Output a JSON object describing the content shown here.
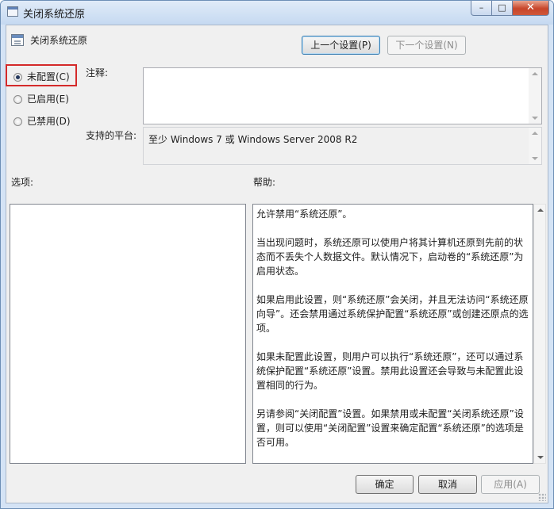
{
  "window": {
    "title": "关闭系统还原",
    "controls": {
      "minimize": "–",
      "maximize": "□",
      "close": "✕"
    }
  },
  "header": {
    "policy_name": "关闭系统还原",
    "prev_button": "上一个设置(P)",
    "next_button": "下一个设置(N)"
  },
  "state_options": {
    "selected": "not_configured",
    "items": [
      {
        "id": "not_configured",
        "label": "未配置(C)"
      },
      {
        "id": "enabled",
        "label": "已启用(E)"
      },
      {
        "id": "disabled",
        "label": "已禁用(D)"
      }
    ]
  },
  "comment": {
    "label": "注释:",
    "value": ""
  },
  "platform": {
    "label": "支持的平台:",
    "value": "至少 Windows 7 或 Windows Server 2008 R2"
  },
  "options": {
    "label": "选项:"
  },
  "help": {
    "label": "帮助:",
    "paragraphs": [
      "允许禁用“系统还原”。",
      "当出现问题时，系统还原可以使用户将其计算机还原到先前的状态而不丢失个人数据文件。默认情况下，启动卷的“系统还原”为启用状态。",
      "如果启用此设置，则“系统还原”会关闭，并且无法访问“系统还原向导”。还会禁用通过系统保护配置“系统还原”或创建还原点的选项。",
      "如果未配置此设置，则用户可以执行“系统还原”，还可以通过系统保护配置“系统还原”设置。禁用此设置还会导致与未配置此设置相同的行为。",
      "另请参阅“关闭配置”设置。如果禁用或未配置“关闭系统还原”设置，则可以使用“关闭配置”设置来确定配置“系统还原”的选项是否可用。"
    ]
  },
  "footer": {
    "ok": "确定",
    "cancel": "取消",
    "apply": "应用(A)"
  },
  "colors": {
    "frame": "#d4e3f5",
    "client": "#f0f0f0",
    "close_button": "#c7452a",
    "highlight": "#d42a2a"
  }
}
